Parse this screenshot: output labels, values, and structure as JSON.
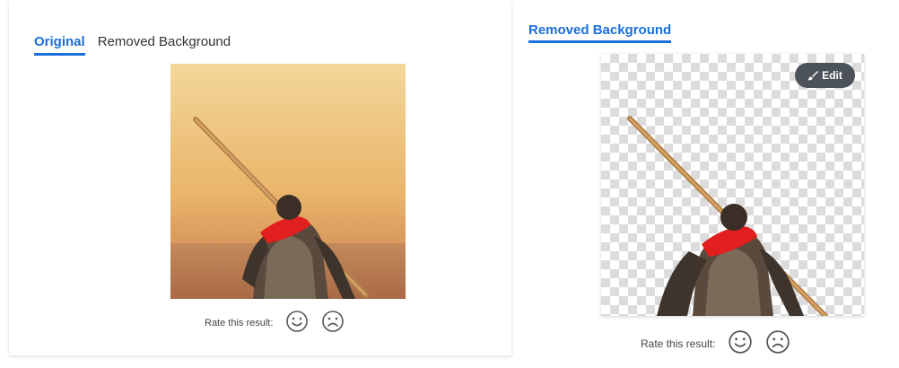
{
  "left_card": {
    "tabs": [
      {
        "label": "Original",
        "active": true
      },
      {
        "label": "Removed Background",
        "active": false
      }
    ],
    "rate_label": "Rate this result:"
  },
  "right_card": {
    "title": "Removed Background",
    "edit_label": "Edit",
    "rate_label": "Rate this result:"
  },
  "icons": {
    "edit": "paintbrush-icon",
    "rate_positive": "smiley-face-icon",
    "rate_negative": "frowning-face-icon"
  },
  "colors": {
    "accent": "#1a6fdc",
    "edit_button_bg": "#4b5259",
    "checker_light": "#ffffff",
    "checker_dark": "#dcdcdc",
    "face_stroke": "#555555"
  }
}
